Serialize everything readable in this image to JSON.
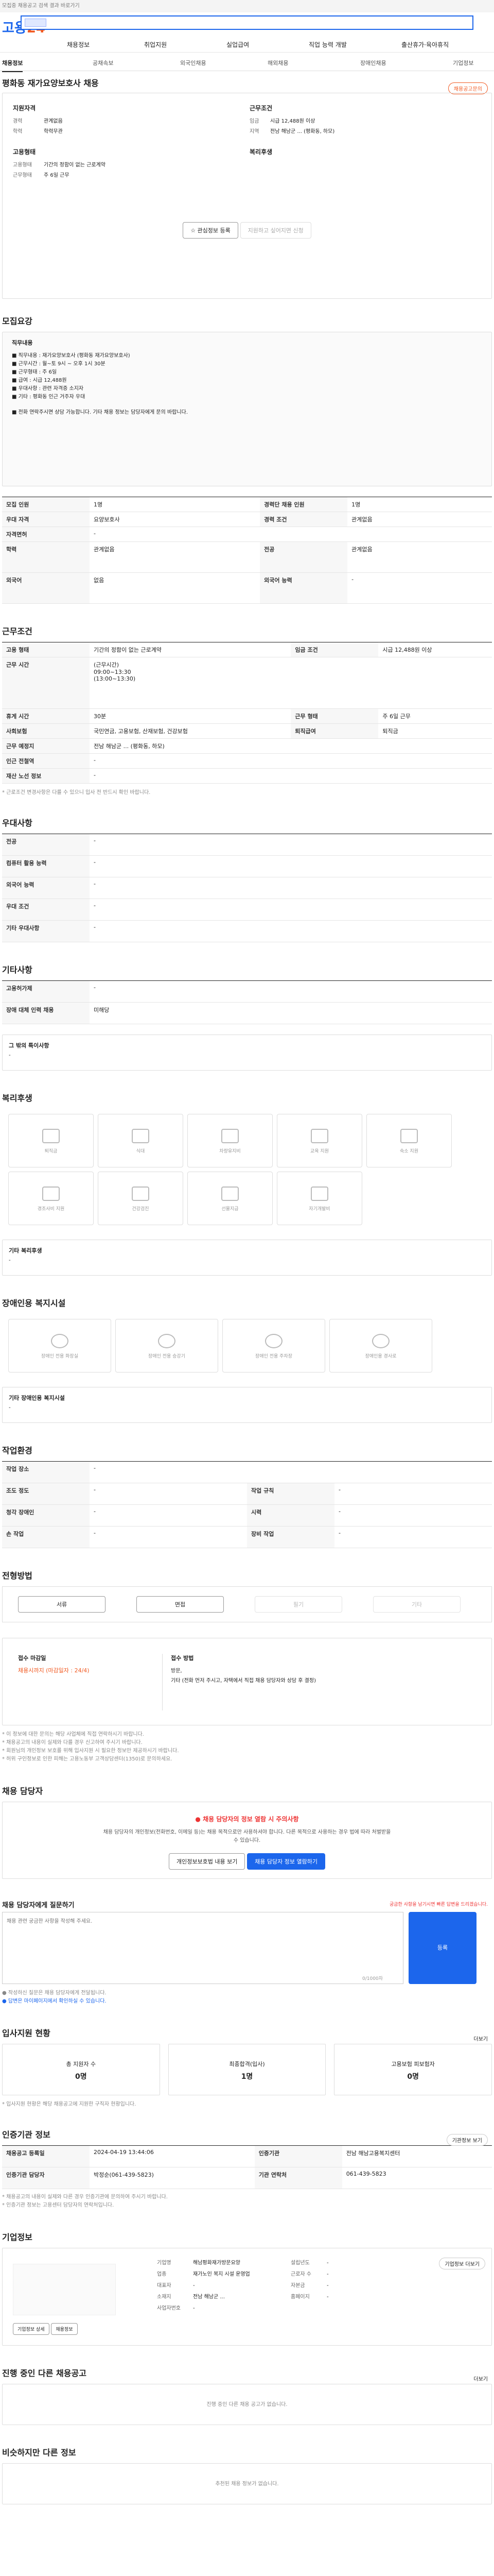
{
  "topbar": {
    "text": "모집중 채용공고 검색 결과 바로가기"
  },
  "brand": {
    "logo_main": "고용",
    "logo_num": "24"
  },
  "gnb": [
    "채용정보",
    "취업지원",
    "실업급여",
    "직업 능력 개발",
    "출산휴가·육아휴직"
  ],
  "lnb": [
    "채용정보",
    "공채속보",
    "외국인채용",
    "해외채용",
    "장애인채용",
    "기업정보"
  ],
  "job": {
    "title": "평화동 재가요양보호사 채용",
    "badge": "채용공고문의",
    "left_head": "지원자격",
    "left_rows": [
      [
        "경력",
        "관계없음"
      ],
      [
        "학력",
        "학력무관"
      ]
    ],
    "right_head": "근무조건",
    "right_rows": [
      [
        "임금",
        "시급 12,488원 이상"
      ],
      [
        "지역",
        "전남 해남군 ... (평화동, 하모)"
      ]
    ],
    "type_head": "고용형태",
    "type_rows": [
      [
        "고용형태",
        "기간의 정함이 없는 근로계약"
      ],
      [
        "근무형태",
        "주 6일 근무"
      ]
    ],
    "benefit_head": "복리후생",
    "btn_apply": "관심정보 등록",
    "btn_share": "지원하고 싶어지면 신청"
  },
  "recruit": {
    "title": "모집요강",
    "box_title": "직무내용",
    "box_lines": [
      "■ 직무내용 : 재가요양보호사 (평화동 재가요양보호사)",
      "■ 근무시간 : 월~토 9시 ~ 오후 1시 30분",
      "■ 근무형태 : 주 6일",
      "■ 급여 : 시급 12,488원",
      "■ 우대사항 : 관련 자격증 소지자",
      "■ 기타 : 평화동 인근 거주자 우대"
    ],
    "box_sub": "■ 전화 연락주시면 상담 가능합니다. 기타 채용 정보는 담당자에게 문의 바랍니다.",
    "rows": [
      [
        "모집 인원",
        "1명",
        "경력단 채용 인원",
        "1명"
      ],
      [
        "우대 자격",
        "요양보호사",
        "경력 조건",
        "관계없음"
      ],
      [
        "자격면허",
        "-",
        "",
        ""
      ],
      [
        "학력",
        "관계없음",
        "전공",
        "관계없음"
      ],
      [
        "외국어",
        "없음",
        "외국어 능력",
        "-"
      ]
    ]
  },
  "work": {
    "title": "근무조건",
    "rows": [
      [
        "고용 형태",
        "기간의 정함이 없는 근로계약",
        "임금 조건",
        "시급 12,488원 이상"
      ],
      [
        "근무 시간",
        "(근무시간)\n09:00~13:30\n(13:00~13:30)",
        "",
        ""
      ],
      [
        "휴게 시간",
        "30분",
        "근무 형태",
        "주 6일 근무"
      ],
      [
        "사회보험",
        "국민연금, 고용보험, 산재보험, 건강보험",
        "퇴직급여",
        "퇴직금"
      ],
      [
        "근무 예정지",
        "전남 해남군 ... (평화동, 하모)",
        "",
        ""
      ],
      [
        "인근 전철역",
        "-",
        "",
        ""
      ],
      [
        "재산 노선 정보",
        "-",
        "",
        ""
      ]
    ],
    "note": "* 근로조건 변경사항은 다를 수 있으니 입사 전 반드시 확인 바랍니다."
  },
  "pref": {
    "title": "우대사항",
    "rows": [
      [
        "전공",
        "-"
      ],
      [
        "컴퓨터 활용 능력",
        "-"
      ],
      [
        "외국어 능력",
        "-"
      ],
      [
        "우대 조건",
        "-"
      ],
      [
        "기타 우대사항",
        "-"
      ]
    ]
  },
  "etc": {
    "title": "기타사항",
    "rows": [
      [
        "고용허가제",
        "-"
      ],
      [
        "장애 대체 인력 채용",
        "미해당"
      ]
    ],
    "other_title": "그 밖의 특이사항",
    "other_val": "-"
  },
  "welfare": {
    "title": "복리후생",
    "items": [
      "퇴직금",
      "식대",
      "차량유지비",
      "교육 지원",
      "숙소 지원",
      "경조사비 지원",
      "건강검진",
      "선물지급",
      "자기개발비"
    ],
    "other_title": "기타 복리후생",
    "other_val": "-"
  },
  "disabled": {
    "title": "장애인용 복지시설",
    "items": [
      "장애인 전용 화장실",
      "장애인 전용 승강기",
      "장애인 전용 주차장",
      "장애인용 경사로"
    ],
    "other_title": "기타 장애인용 복지시설",
    "other_val": "-"
  },
  "env": {
    "title": "작업환경",
    "rows": [
      [
        "작업 장소",
        "-",
        "",
        ""
      ],
      [
        "조도 정도",
        "-",
        "작업 규칙",
        "-"
      ],
      [
        "청각 장애인",
        "-",
        "시력",
        "-"
      ],
      [
        "손 작업",
        "-",
        "장비 작업",
        "-"
      ]
    ]
  },
  "apply": {
    "title": "전형방법",
    "steps": [
      "서류",
      "면접",
      "필기",
      "기타"
    ],
    "left_head": "접수 마감일",
    "left_val": "채용시까지 (마감일자 : 24/4)",
    "right_head": "접수 방법",
    "right_lines": [
      "방문,",
      "기타 (전화 먼저 주시고, 자택에서 직접 채용 담당자와 상담 후 결정)"
    ],
    "notes": [
      "* 이 정보에 대한 문의는 해당 사업체에 직접 연락하시기 바랍니다.",
      "* 채용공고의 내용이 실제와 다를 경우 신고하여 주시기 바랍니다.",
      "* 회원님의 개인정보 보호를 위해 입사지원 시 필요한 정보만 제공하시기 바랍니다.",
      "* 허위 구인정보로 인한 피해는 고용노동부 고객상담센터(1350)로 문의하세요."
    ]
  },
  "contact": {
    "title": "채용 담당자",
    "alert": "채용 담당자의 정보 열람 시 주의사항",
    "desc": "채용 담당자의 개인정보(전화번호, 이메일 등)는 채용 목적으로만 사용하셔야 합니다. 다른 목적으로 사용하는 경우 법에 따라 처벌받을 수 있습니다.",
    "btn1": "개인정보보호법 내용 보기",
    "btn2": "채용 담당자 정보 열람하기"
  },
  "inquiry": {
    "title": "채용 담당자에게 질문하기",
    "hint": "궁금한 사항을 남기시면 빠른 답변을 드리겠습니다.",
    "placeholder": "채용 관련 궁금한 사항을 작성해 주세요.",
    "count": "0/1000자",
    "btn": "등록",
    "notes": [
      "● 작성하신 질문은 채용 담당자에게 전달됩니다.",
      "● 답변은 마이페이지에서 확인하실 수 있습니다."
    ]
  },
  "stats": {
    "title": "입사지원 현황",
    "link": "더보기",
    "boxes": [
      [
        "총 지원자 수",
        "0명"
      ],
      [
        "최종합격(입사)",
        "1명"
      ],
      [
        "고용보험 피보험자",
        "0명"
      ]
    ],
    "note": "* 입사지원 현황은 해당 채용공고에 지원한 구직자 현황입니다."
  },
  "auth": {
    "title": "인증기관 정보",
    "link": "기관정보 보기",
    "rows": [
      [
        "채용공고 등록일",
        "2024-04-19 13:44:06",
        "인증기관",
        "전남 해남고용복지센터"
      ],
      [
        "인증기관 담당자",
        "박정순(061-439-5823)",
        "기관 연락처",
        "061-439-5823"
      ]
    ],
    "notes": [
      "* 채용공고의 내용이 실제와 다른 경우 인증기관에 문의하여 주시기 바랍니다.",
      "* 인증기관 정보는 고용센터 담당자의 연락처입니다."
    ]
  },
  "company": {
    "title": "기업정보",
    "btn_more": "기업정보 더보기",
    "rows": [
      [
        "기업명",
        "해남평화재가방문요양"
      ],
      [
        "업종",
        "재가노인 복지 시설 운영업"
      ],
      [
        "대표자",
        "-"
      ],
      [
        "소재지",
        "전남 해남군 ..."
      ],
      [
        "사업자번호",
        "-"
      ]
    ],
    "rows2": [
      [
        "설립년도",
        "-"
      ],
      [
        "근로자 수",
        "-"
      ],
      [
        "자본금",
        "-"
      ],
      [
        "홈페이지",
        "-"
      ]
    ],
    "btn1": "기업정보 상세",
    "btn2": "채용정보"
  },
  "others": {
    "title": "진행 중인 다른 채용공고",
    "link": "더보기",
    "empty": "진행 중인 다른 채용 공고가 없습니다."
  },
  "similar": {
    "title": "비슷하지만 다른 정보",
    "empty": "추천된 채용 정보가 없습니다."
  }
}
